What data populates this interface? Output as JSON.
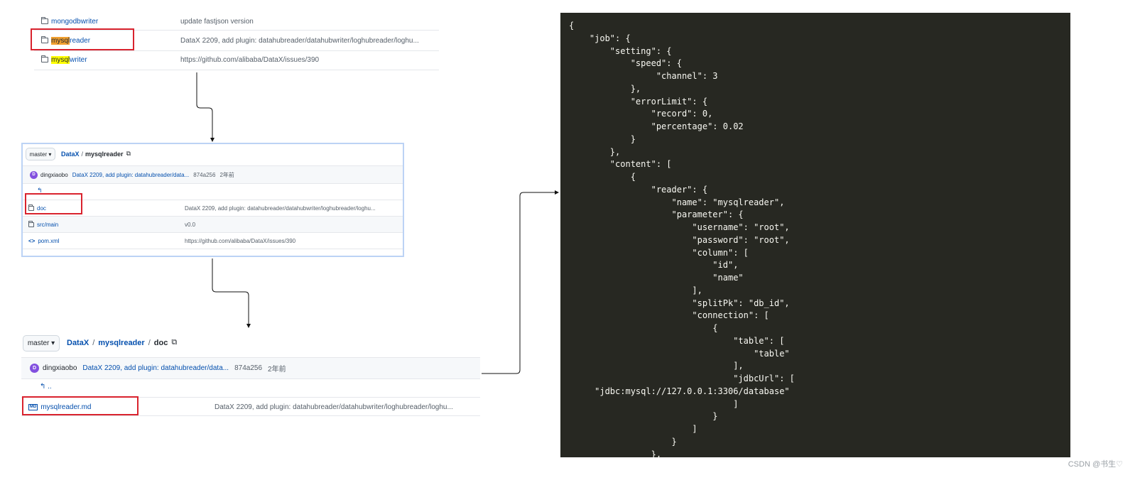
{
  "repo_list_top": {
    "rows": [
      {
        "name": "mongodbwriter",
        "message": "update fastjson version"
      },
      {
        "name_prefix": "mysql",
        "name_suffix": "reader",
        "message": "DataX 2209, add plugin: datahubreader/datahubwriter/loghubreader/loghu..."
      },
      {
        "name_prefix": "mysql",
        "name_suffix": "writer",
        "message": "https://github.com/alibaba/DataX/issues/390"
      }
    ]
  },
  "panel_mysqlreader": {
    "branch": "master ▾",
    "breadcrumb": {
      "root": "DataX",
      "sep": "/",
      "dir": "mysqlreader"
    },
    "commit": {
      "avatar": "D",
      "author": "dingxiaobo",
      "message": "DataX 2209, add plugin: datahubreader/data...",
      "hash": "874a256",
      "time": "2年前"
    },
    "back": "↰",
    "files": [
      {
        "name": "doc",
        "message": "DataX 2209, add plugin: datahubreader/datahubwriter/loghubreader/loghu..."
      },
      {
        "name": "src/main",
        "message": "v0.0"
      },
      {
        "name": "pom.xml",
        "message": "https://github.com/alibaba/DataX/issues/390"
      }
    ]
  },
  "panel_doc": {
    "branch": "master ▾",
    "breadcrumb": {
      "root": "DataX",
      "sep1": "/",
      "dir": "mysqlreader",
      "sep2": "/",
      "leaf": "doc"
    },
    "commit": {
      "avatar": "D",
      "author": "dingxiaobo",
      "message": "DataX 2209, add plugin: datahubreader/data...",
      "hash": "874a256",
      "time": "2年前"
    },
    "back": "↰ ..",
    "file": {
      "icon_label": "MD",
      "name": "mysqlreader.md",
      "message": "DataX 2209, add plugin: datahubreader/datahubwriter/loghubreader/loghu..."
    }
  },
  "json_code": "{\n    \"job\": {\n        \"setting\": {\n            \"speed\": {\n                 \"channel\": 3\n            },\n            \"errorLimit\": {\n                \"record\": 0,\n                \"percentage\": 0.02\n            }\n        },\n        \"content\": [\n            {\n                \"reader\": {\n                    \"name\": \"mysqlreader\",\n                    \"parameter\": {\n                        \"username\": \"root\",\n                        \"password\": \"root\",\n                        \"column\": [\n                            \"id\",\n                            \"name\"\n                        ],\n                        \"splitPk\": \"db_id\",\n                        \"connection\": [\n                            {\n                                \"table\": [\n                                    \"table\"\n                                ],\n                                \"jdbcUrl\": [\n     \"jdbc:mysql://127.0.0.1:3306/database\"\n                                ]\n                            }\n                        ]\n                    }\n                },",
  "footer": "CSDN @书生♡"
}
